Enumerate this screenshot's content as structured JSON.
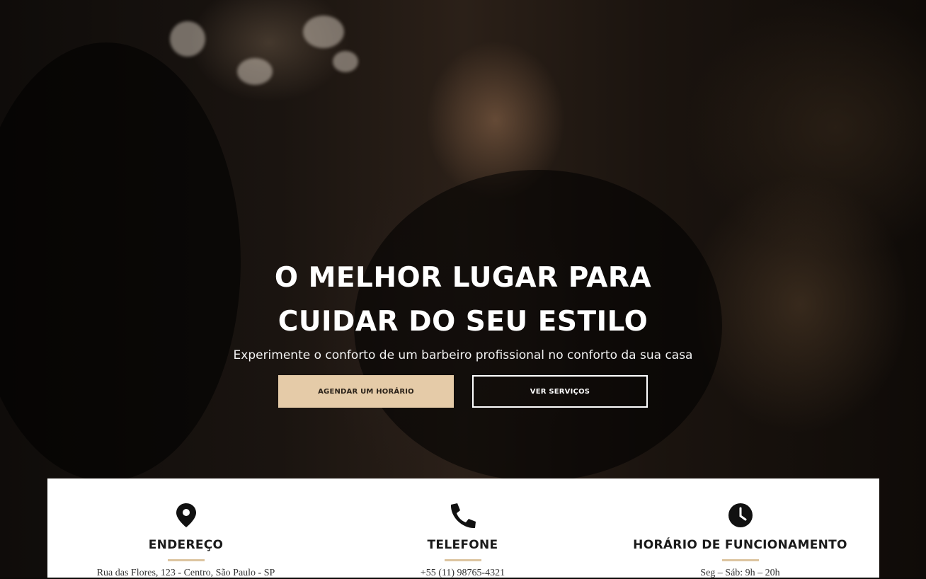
{
  "hero": {
    "title_line1": "O MELHOR LUGAR PARA",
    "title_line2": "CUIDAR DO SEU ESTILO",
    "subtitle": "Experimente o conforto de um barbeiro profissional no conforto da sua casa",
    "primary_button": "AGENDAR UM HORÁRIO",
    "secondary_button": "VER SERVIÇOS"
  },
  "info": [
    {
      "icon": "map-pin-icon",
      "label": "ENDEREÇO",
      "value": "Rua das Flores, 123 - Centro, São Paulo - SP"
    },
    {
      "icon": "phone-icon",
      "label": "TELEFONE",
      "value": "+55 (11) 98765-4321"
    },
    {
      "icon": "clock-icon",
      "label": "HORÁRIO DE FUNCIONAMENTO",
      "value": "Seg – Sáb: 9h – 20h"
    }
  ],
  "colors": {
    "accent": "#e5cba8",
    "underline": "#dcc4a0",
    "text_dark": "#1a1a1a"
  }
}
